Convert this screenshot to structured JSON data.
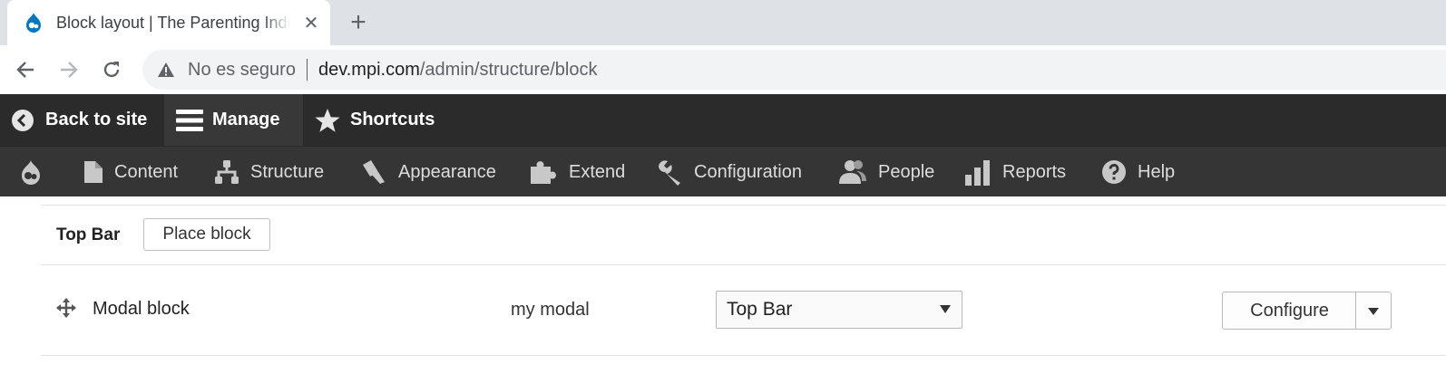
{
  "browser": {
    "tab_title": "Block layout | The Parenting Index",
    "close_symbol": "✕",
    "new_tab_symbol": "+",
    "security_label": "No es seguro",
    "url_host": "dev.mpi.com",
    "url_path": "/admin/structure/block"
  },
  "toolbar": {
    "back_to_site": "Back to site",
    "manage": "Manage",
    "shortcuts": "Shortcuts"
  },
  "tray": {
    "items": [
      {
        "label": "Content",
        "icon": "file-icon"
      },
      {
        "label": "Structure",
        "icon": "sitemap-icon"
      },
      {
        "label": "Appearance",
        "icon": "paintbrush-icon"
      },
      {
        "label": "Extend",
        "icon": "puzzle-icon"
      },
      {
        "label": "Configuration",
        "icon": "wrench-icon"
      },
      {
        "label": "People",
        "icon": "people-icon"
      },
      {
        "label": "Reports",
        "icon": "bar-chart-icon"
      },
      {
        "label": "Help",
        "icon": "help-icon"
      }
    ]
  },
  "region": {
    "title": "Top Bar",
    "place_block_label": "Place block"
  },
  "block_row": {
    "name": "Modal block",
    "category": "my modal",
    "region_value": "Top Bar",
    "configure_label": "Configure"
  },
  "colors": {
    "toolbar_bg": "#2b2b2b",
    "tray_bg": "#353535",
    "drupal_blue": "#0678be"
  }
}
